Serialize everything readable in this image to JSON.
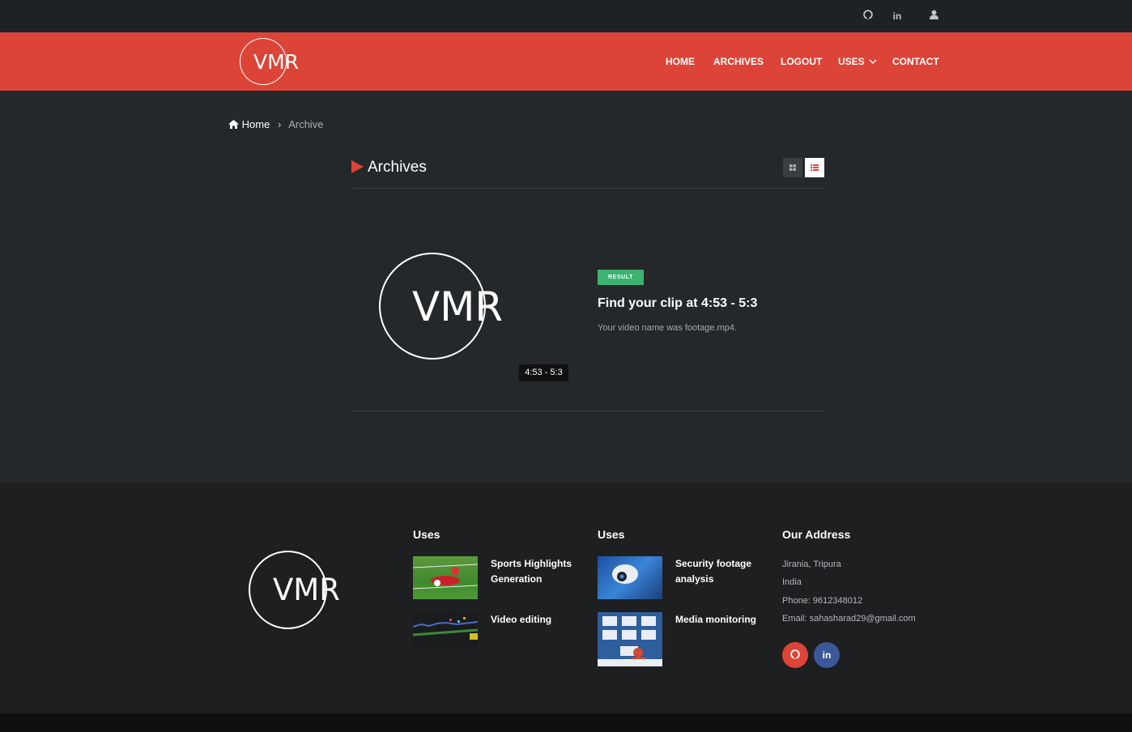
{
  "topbar": {
    "icons": [
      "github-icon",
      "linkedin-icon",
      "user-icon"
    ],
    "linkedin_label": "in"
  },
  "header": {
    "logo_text": "VMR",
    "nav": [
      "HOME",
      "ARCHIVES",
      "LOGOUT",
      "USES",
      "CONTACT"
    ]
  },
  "breadcrumb": {
    "home": "Home",
    "current": "Archive"
  },
  "archives": {
    "title": "Archives",
    "view_modes": [
      "grid-view-icon",
      "list-view-icon"
    ],
    "active_view": "list",
    "item": {
      "thumbnail_text": "VMR",
      "duration": "4:53 - 5:3",
      "badge": "RESULT",
      "title": "Find your clip at 4:53 - 5:3",
      "description": "Your video name was footage.mp4."
    }
  },
  "footer": {
    "logo_text": "VMR",
    "uses_col1": {
      "heading": "Uses",
      "items": [
        "Sports Highlights Generation",
        "Video editing"
      ]
    },
    "uses_col2": {
      "heading": "Uses",
      "items": [
        "Security footage analysis",
        "Media monitoring"
      ]
    },
    "address": {
      "heading": "Our Address",
      "line1": "Jirania, Tripura",
      "line2": "India",
      "phone": "Phone: 9612348012",
      "email": "Email: sahasharad29@gmail.com"
    },
    "social": [
      "github-icon",
      "linkedin-icon"
    ],
    "linkedin_label": "in"
  },
  "colors": {
    "accent": "#db4437",
    "badge": "#3cb371",
    "linkedin": "#3b5998"
  }
}
